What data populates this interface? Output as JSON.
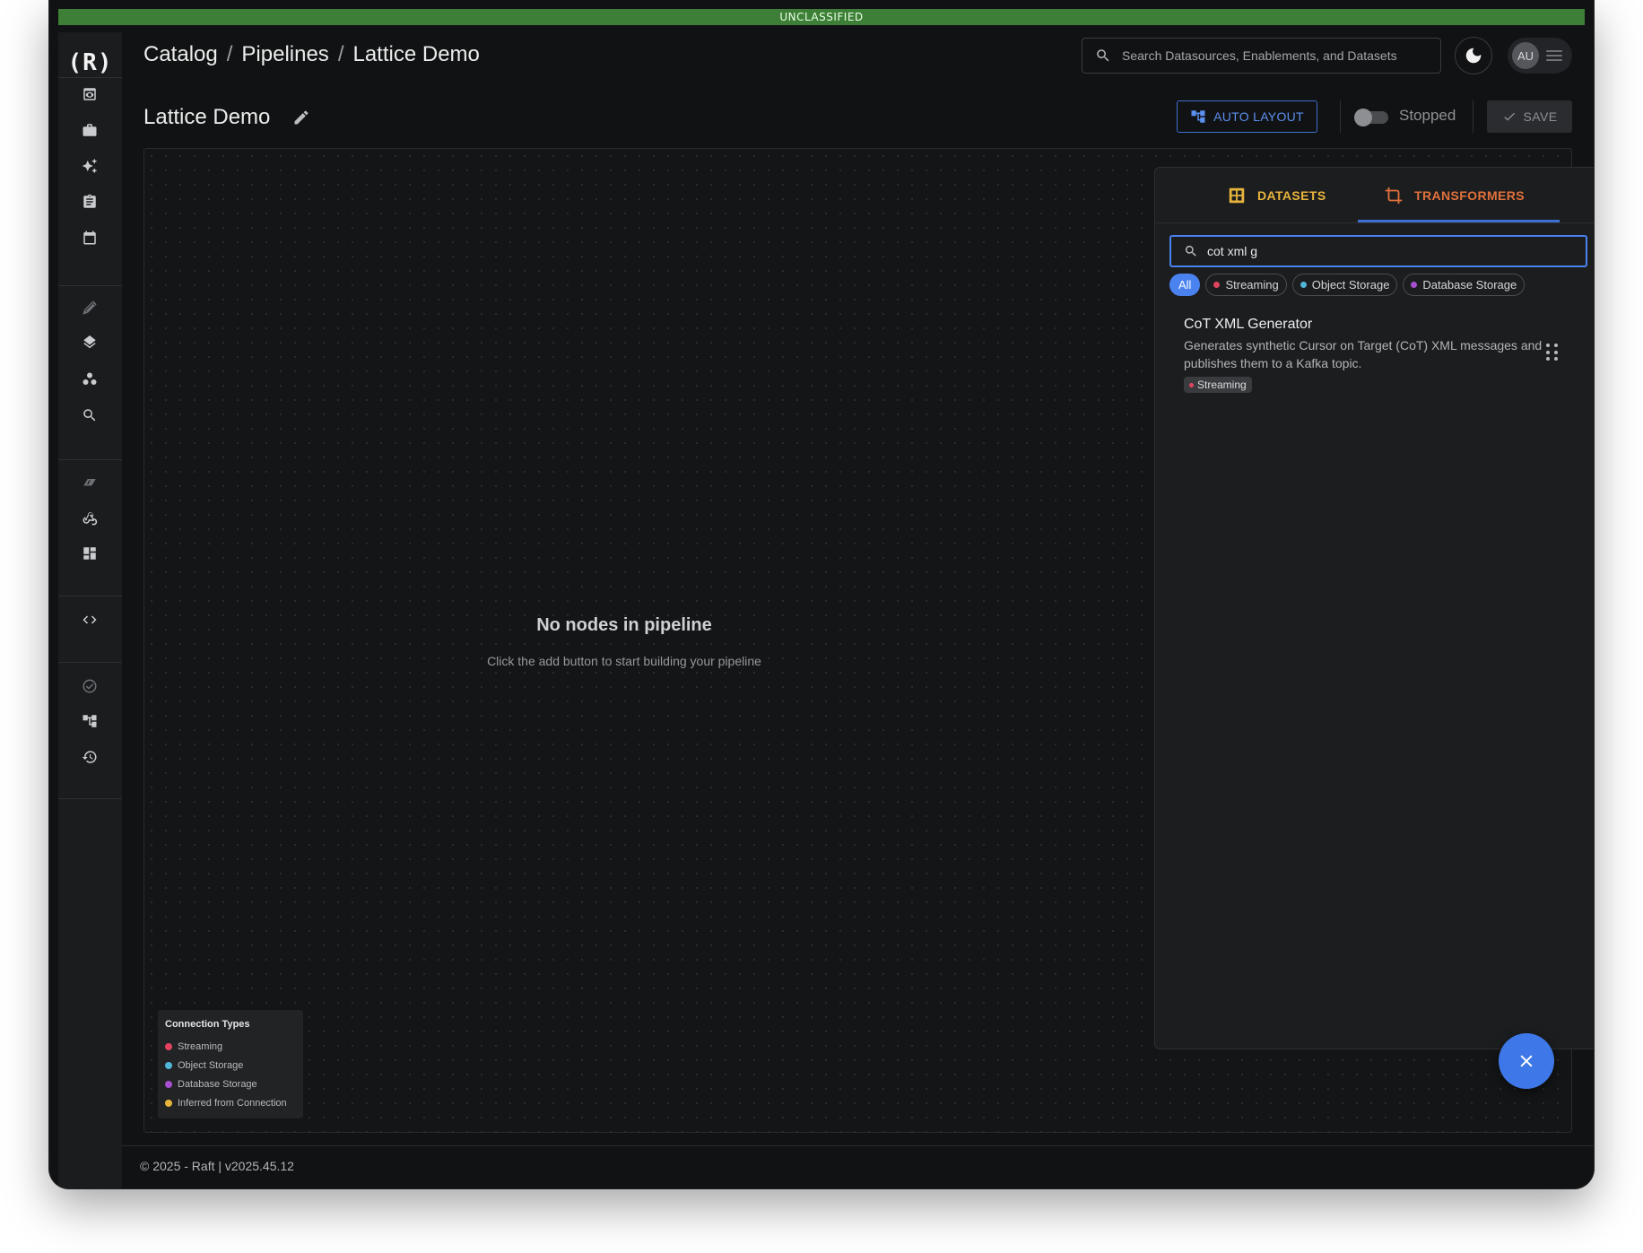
{
  "classification": "UNCLASSIFIED",
  "brand": {
    "logo_text": "(R)"
  },
  "sidebar": {
    "groups": [
      [
        {
          "icon": "preview-icon"
        },
        {
          "icon": "briefcase-icon"
        },
        {
          "icon": "sparkles-icon"
        },
        {
          "icon": "clipboard-icon"
        },
        {
          "icon": "calendar-icon"
        }
      ],
      [
        {
          "icon": "feather-icon"
        },
        {
          "icon": "layers-icon"
        },
        {
          "icon": "workspaces-icon"
        },
        {
          "icon": "search-icon"
        }
      ],
      [
        {
          "icon": "arrows-icon"
        },
        {
          "icon": "webhook-icon"
        },
        {
          "icon": "dashboard-icon"
        }
      ],
      [
        {
          "icon": "code-icon"
        }
      ],
      [
        {
          "icon": "policy-icon"
        },
        {
          "icon": "pipeline-icon"
        },
        {
          "icon": "history-icon"
        }
      ]
    ]
  },
  "header": {
    "breadcrumb": [
      "Catalog",
      "Pipelines",
      "Lattice Demo"
    ],
    "search_placeholder": "Search Datasources, Enablements, and Datasets",
    "user_initials": "AU"
  },
  "toolbar": {
    "title": "Lattice Demo",
    "auto_layout_label": "AUTO LAYOUT",
    "status_label": "Stopped",
    "save_label": "SAVE"
  },
  "canvas": {
    "empty_title": "No nodes in pipeline",
    "empty_subtitle": "Click the add button to start building your pipeline"
  },
  "legend": {
    "title": "Connection Types",
    "items": [
      {
        "label": "Streaming",
        "color": "#e0435f"
      },
      {
        "label": "Object Storage",
        "color": "#4fb6d8"
      },
      {
        "label": "Database Storage",
        "color": "#a74fd0"
      },
      {
        "label": "Inferred from Connection",
        "color": "#e8b53c"
      }
    ]
  },
  "panel": {
    "tabs": [
      {
        "label": "DATASETS",
        "icon": "grid-icon",
        "color": "#e8b53c"
      },
      {
        "label": "TRANSFORMERS",
        "icon": "crop-icon",
        "color": "#e2713c",
        "active": true
      }
    ],
    "search_value": "cot xml g",
    "filters": [
      {
        "label": "All",
        "active": true
      },
      {
        "label": "Streaming",
        "color": "#e0435f"
      },
      {
        "label": "Object Storage",
        "color": "#4fb6d8"
      },
      {
        "label": "Database Storage",
        "color": "#a74fd0"
      }
    ],
    "results": [
      {
        "title": "CoT XML Generator",
        "description": "Generates synthetic Cursor on Target (CoT) XML messages and publishes them to a Kafka topic.",
        "tag": "Streaming",
        "tag_color": "#e0435f"
      }
    ]
  },
  "footer": {
    "text": "© 2025 - Raft  | v2025.45.12"
  }
}
